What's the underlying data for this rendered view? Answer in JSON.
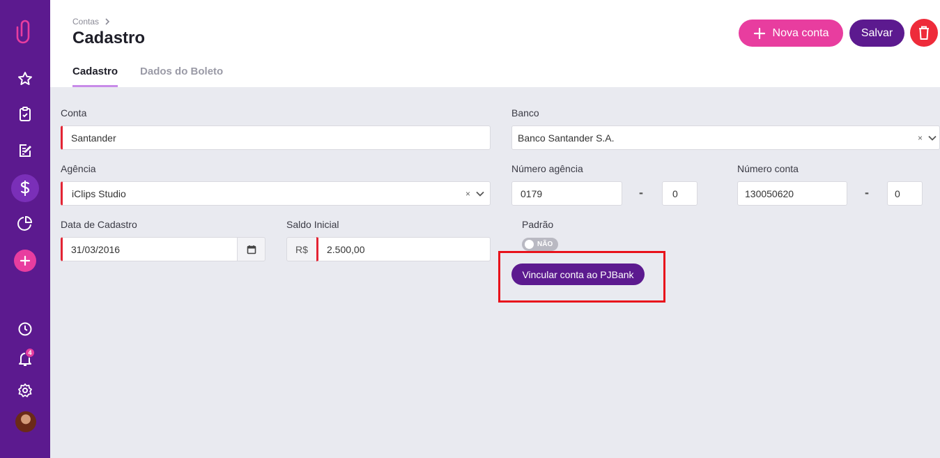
{
  "header": {
    "breadcrumb": "Contas",
    "title": "Cadastro",
    "tabs": [
      {
        "label": "Cadastro",
        "active": true
      },
      {
        "label": "Dados do Boleto",
        "active": false
      }
    ],
    "new_button": "Nova conta",
    "save_button": "Salvar"
  },
  "sidebar": {
    "notification_count": "4",
    "icons": [
      "paperclip-logo-icon",
      "star-icon",
      "clipboard-icon",
      "edit-icon",
      "dollar-icon",
      "pie-chart-icon",
      "plus-icon",
      "clock-icon",
      "bell-icon",
      "gear-icon"
    ]
  },
  "form": {
    "conta": {
      "label": "Conta",
      "value": "Santander"
    },
    "banco": {
      "label": "Banco",
      "value": "Banco Santander S.A."
    },
    "agencia": {
      "label": "Agência",
      "value": "iClips Studio"
    },
    "numero_agencia": {
      "label": "Número agência",
      "value": "0179",
      "digit": "0"
    },
    "numero_conta": {
      "label": "Número conta",
      "value": "130050620",
      "digit": "0"
    },
    "data_cadastro": {
      "label": "Data de Cadastro",
      "value": "31/03/2016"
    },
    "saldo_inicial": {
      "label": "Saldo Inicial",
      "currency": "R$",
      "value": "2.500,00"
    },
    "padrao": {
      "label": "Padrão",
      "toggle_text": "NÃO",
      "on": false
    },
    "pjbank_button": "Vincular conta ao PJBank",
    "separator": "-",
    "clear_symbol": "×"
  },
  "colors": {
    "sidebar": "#5c1a8f",
    "accent_pink": "#e83d9f",
    "primary_purple": "#5c1a8f",
    "danger": "#ee2b3a",
    "required": "#e32434",
    "highlight": "#e8121b"
  }
}
